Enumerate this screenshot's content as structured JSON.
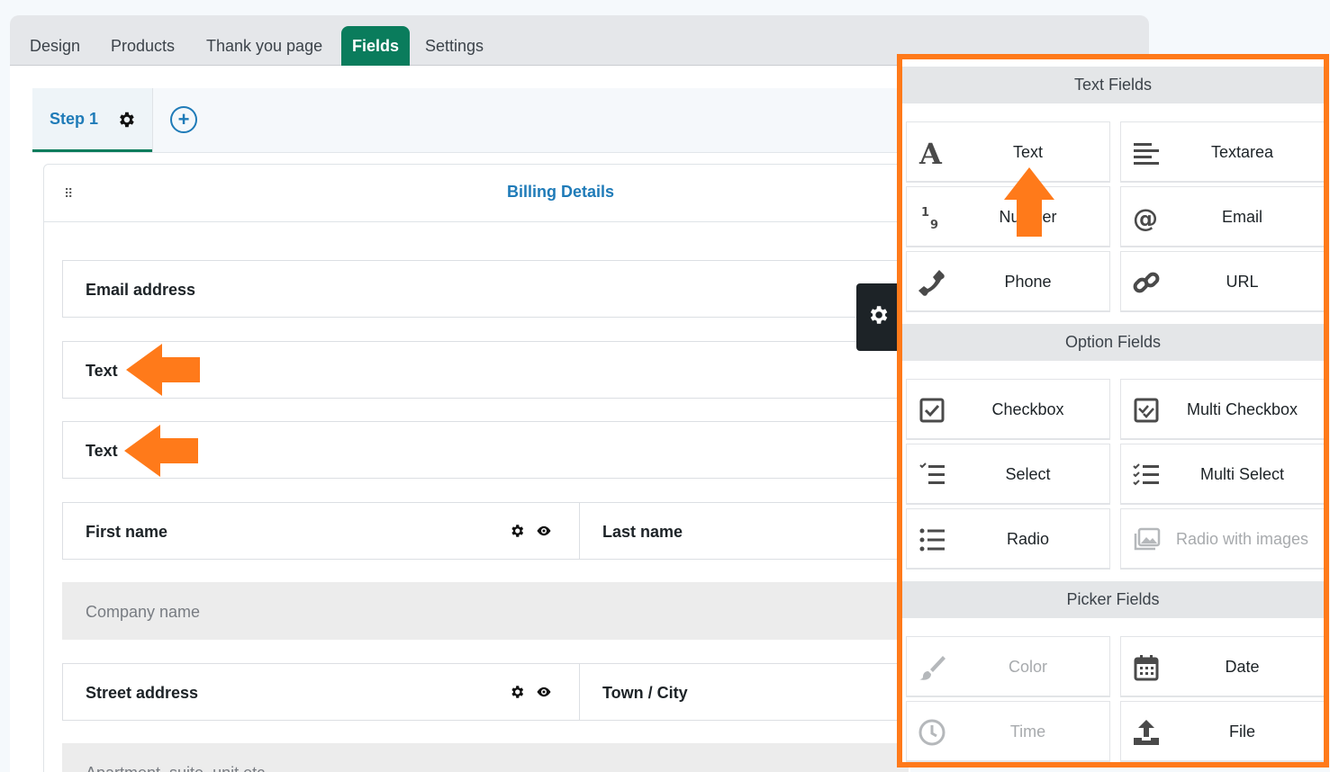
{
  "tabs": [
    {
      "label": "Design"
    },
    {
      "label": "Products"
    },
    {
      "label": "Thank you page"
    },
    {
      "label": "Fields",
      "active": true
    },
    {
      "label": "Settings"
    }
  ],
  "steps": {
    "current": "Step 1",
    "add": "+"
  },
  "section": {
    "title": "Billing Details"
  },
  "fields": {
    "email": "Email address",
    "text1": "Text",
    "text2": "Text",
    "first_name": "First name",
    "last_name": "Last name",
    "company": "Company name",
    "street": "Street address",
    "town": "Town / City",
    "apartment": "Apartment, suite, unit etc."
  },
  "panel": {
    "text_group": "Text Fields",
    "text_fields": [
      "Text",
      "Textarea",
      "Number",
      "Email",
      "Phone",
      "URL"
    ],
    "option_group": "Option Fields",
    "option_fields": [
      "Checkbox",
      "Multi Checkbox",
      "Select",
      "Multi Select",
      "Radio",
      "Radio with images"
    ],
    "picker_group": "Picker Fields",
    "picker_fields": [
      "Color",
      "Date",
      "Time",
      "File"
    ]
  },
  "colors": {
    "accent": "#0a7c5c",
    "link": "#1f7bb8",
    "highlight": "#ff7a1a"
  }
}
